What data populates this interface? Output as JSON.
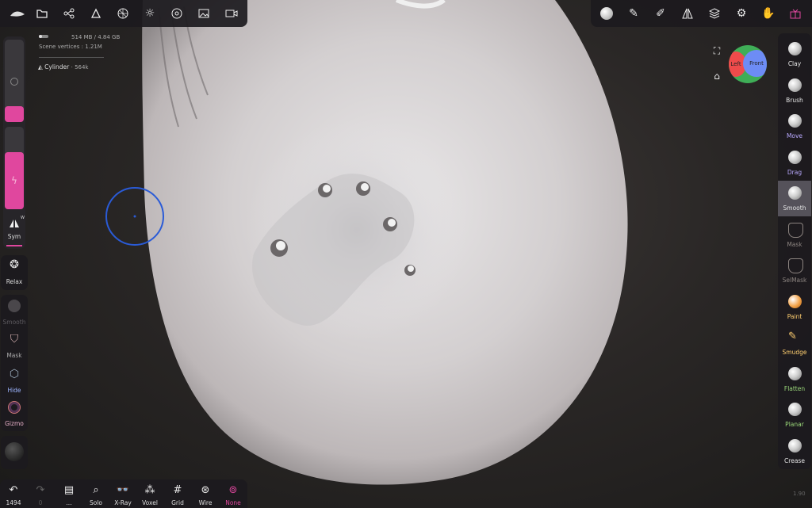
{
  "stats": {
    "memory": "514 MB / 4.84 GB",
    "vertices": "Scene vertices : 1.21M",
    "object": "Cylinder",
    "object_verts": "· 564k"
  },
  "left": {
    "sym": "Sym",
    "sym_badge": "W",
    "relax": "Relax",
    "smooth": "Smooth",
    "mask": "Mask",
    "hide": "Hide",
    "gizmo": "Gizmo"
  },
  "gizmo": {
    "left": "Left",
    "front": "Front"
  },
  "tools": [
    {
      "label": "Clay",
      "color": "#e6e6e6"
    },
    {
      "label": "Brush",
      "color": "#e6e6e6"
    },
    {
      "label": "Move",
      "color": "#b9a9ff"
    },
    {
      "label": "Drag",
      "color": "#b9a9ff"
    },
    {
      "label": "Smooth",
      "color": "#e6e6e6"
    },
    {
      "label": "Mask",
      "color": "#8c8480"
    },
    {
      "label": "SelMask",
      "color": "#8c8480"
    },
    {
      "label": "Paint",
      "color": "#ffcf70"
    },
    {
      "label": "Smudge",
      "color": "#ffcf70"
    },
    {
      "label": "Flatten",
      "color": "#9bd87a"
    },
    {
      "label": "Planar",
      "color": "#9bd87a"
    },
    {
      "label": "Crease",
      "color": "#e6e6e6"
    }
  ],
  "bottom": {
    "undo": "1494",
    "redo": "0",
    "dots": "...",
    "solo": "Solo",
    "xray": "X-Ray",
    "voxel": "Voxel",
    "grid": "Grid",
    "wire": "Wire",
    "none": "None"
  },
  "version": "1.90",
  "colors": {
    "accent": "#e0479e",
    "active_tool_bg": "#55525a",
    "cursor": "#2a5bd7",
    "gizmo_red": "#ef4b4b",
    "gizmo_blue": "#6d8cf5",
    "gizmo_green": "#3fae57"
  },
  "icons": {
    "top_left": [
      "logo-icon",
      "folder-icon",
      "scene-graph-icon",
      "cube-tool-icon",
      "sphere-grid-icon",
      "sun-icon",
      "material-icon",
      "image-icon",
      "camera-icon"
    ],
    "top_right": [
      "brush-settings-icon",
      "stroke-icon",
      "pen-icon",
      "symmetry-icon",
      "layers-icon",
      "settings-icon",
      "gesture-icon",
      "gift-icon"
    ]
  }
}
